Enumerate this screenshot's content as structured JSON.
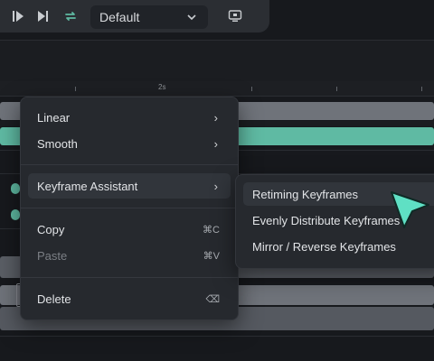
{
  "toolbar": {
    "preset_value": "Default",
    "icons": [
      "play-icon",
      "step-forward-icon",
      "loop-icon",
      "chevron-down-icon",
      "monitor-icon"
    ],
    "accent": "#5fbaa3"
  },
  "ruler": {
    "label_2s": "2s"
  },
  "context_menu": {
    "items": [
      {
        "label": "Linear",
        "submenu": true
      },
      {
        "label": "Smooth",
        "submenu": true
      },
      {
        "label": "Keyframe Assistant",
        "submenu": true
      },
      {
        "label": "Copy",
        "shortcut": "⌘C"
      },
      {
        "label": "Paste",
        "shortcut": "⌘V",
        "disabled": true
      },
      {
        "label": "Delete",
        "shortcut": "⌫"
      }
    ],
    "arrow": "›"
  },
  "submenu": {
    "items": [
      {
        "label": "Retiming Keyframes"
      },
      {
        "label": "Evenly Distribute Keyframes"
      },
      {
        "label": "Mirror / Reverse Keyframes"
      }
    ]
  },
  "colors": {
    "track_gray": "#6f737a",
    "track_teal": "#5fbaa3",
    "cursor": "#5fe0c4"
  }
}
